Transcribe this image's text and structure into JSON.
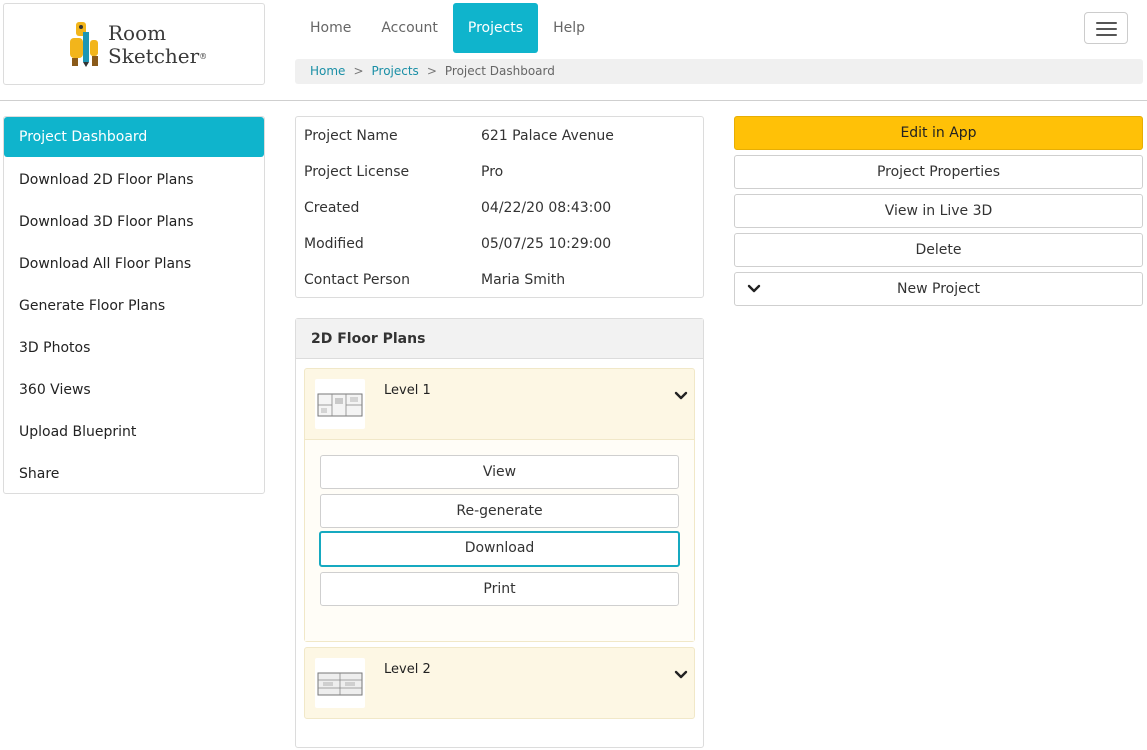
{
  "brand": {
    "line1": "Room",
    "line2": "Sketcher",
    "reg": "®"
  },
  "nav": {
    "items": [
      {
        "label": "Home"
      },
      {
        "label": "Account"
      },
      {
        "label": "Projects",
        "active": true
      },
      {
        "label": "Help"
      }
    ]
  },
  "breadcrumb": {
    "home": "Home",
    "projects": "Projects",
    "current": "Project Dashboard",
    "separator": ">"
  },
  "sidebar": {
    "items": [
      {
        "label": "Project Dashboard",
        "active": true
      },
      {
        "label": "Download 2D Floor Plans"
      },
      {
        "label": "Download 3D Floor Plans"
      },
      {
        "label": "Download All Floor Plans"
      },
      {
        "label": "Generate Floor Plans"
      },
      {
        "label": "3D Photos"
      },
      {
        "label": "360 Views"
      },
      {
        "label": "Upload Blueprint"
      },
      {
        "label": "Share"
      }
    ]
  },
  "project": {
    "rows": [
      {
        "key": "Project Name",
        "value": "621 Palace Avenue"
      },
      {
        "key": "Project License",
        "value": "Pro"
      },
      {
        "key": "Created",
        "value": "04/22/20 08:43:00"
      },
      {
        "key": "Modified",
        "value": "05/07/25 10:29:00"
      },
      {
        "key": "Contact Person",
        "value": "Maria Smith"
      }
    ]
  },
  "floorplans": {
    "title": "2D Floor Plans",
    "levels": [
      {
        "name": "Level 1",
        "expanded": true,
        "buttons": [
          "View",
          "Re-generate",
          "Download",
          "Print"
        ]
      },
      {
        "name": "Level 2",
        "expanded": false
      }
    ]
  },
  "actions": {
    "edit": "Edit in App",
    "properties": "Project Properties",
    "live3d": "View in Live 3D",
    "delete": "Delete",
    "new_project": "New Project"
  },
  "colors": {
    "accent": "#0fb4cc",
    "primary_button": "#ffc107",
    "level_bg": "#fdf7e4"
  }
}
